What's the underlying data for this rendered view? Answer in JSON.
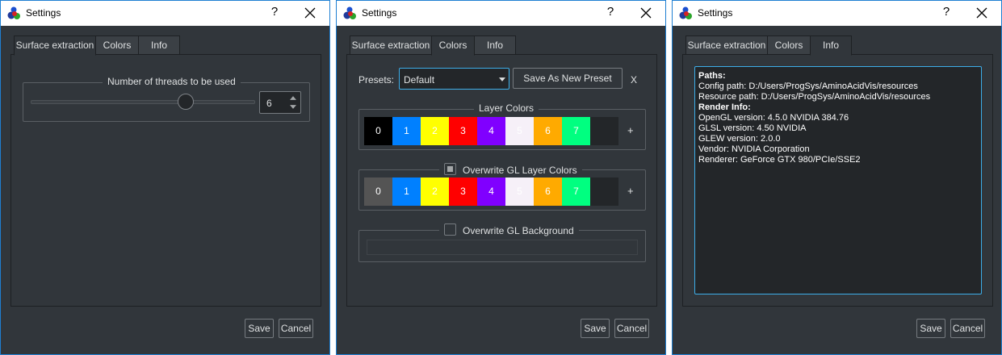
{
  "window": {
    "title": "Settings",
    "help": "?"
  },
  "tabs": [
    "Surface extraction",
    "Colors",
    "Info"
  ],
  "buttons": {
    "save": "Save",
    "cancel": "Cancel"
  },
  "surface": {
    "group_title": "Number of threads to be used",
    "threads": "6",
    "slider_fraction": 0.7
  },
  "colors": {
    "presets_label": "Presets:",
    "preset_value": "Default",
    "save_preset": "Save As New Preset",
    "remove_preset": "X",
    "layer_group_title": "Layer Colors",
    "layer_colors": [
      {
        "label": "0",
        "bg": "#000000"
      },
      {
        "label": "1",
        "bg": "#0080ff"
      },
      {
        "label": "2",
        "bg": "#ffff00"
      },
      {
        "label": "3",
        "bg": "#ff0000"
      },
      {
        "label": "4",
        "bg": "#8000ff"
      },
      {
        "label": "5",
        "bg": "#f6f0f8"
      },
      {
        "label": "6",
        "bg": "#ffaa00"
      },
      {
        "label": "7",
        "bg": "#00ff80"
      },
      {
        "label": "",
        "bg": "#232629"
      }
    ],
    "gl_layer_title": "Overwrite GL Layer Colors",
    "gl_layer_colors": [
      {
        "label": "0",
        "bg": "#545454"
      },
      {
        "label": "1",
        "bg": "#0080ff"
      },
      {
        "label": "2",
        "bg": "#ffff00"
      },
      {
        "label": "3",
        "bg": "#ff0000"
      },
      {
        "label": "4",
        "bg": "#8000ff"
      },
      {
        "label": "5",
        "bg": "#f6f0f8"
      },
      {
        "label": "6",
        "bg": "#ffaa00"
      },
      {
        "label": "7",
        "bg": "#00ff80"
      },
      {
        "label": "",
        "bg": "#232629"
      }
    ],
    "add": "+",
    "gl_background_title": "Overwrite GL Background"
  },
  "info": {
    "paths_heading": "Paths:",
    "config_path": "Config path: D:/Users/ProgSys/AminoAcidVis/resources",
    "resource_path": "Resource path: D:/Users/ProgSys/AminoAcidVis/resources",
    "render_heading": "Render Info:",
    "opengl": "OpenGL version: 4.5.0 NVIDIA 384.76",
    "glsl": "GLSL version: 4.50 NVIDIA",
    "glew": "GLEW version: 2.0.0",
    "vendor": "Vendor: NVIDIA Corporation",
    "renderer": "Renderer: GeForce GTX 980/PCIe/SSE2"
  },
  "theme": {
    "accent": "#1e7fd2",
    "background": "#31363b",
    "field": "#232629"
  }
}
